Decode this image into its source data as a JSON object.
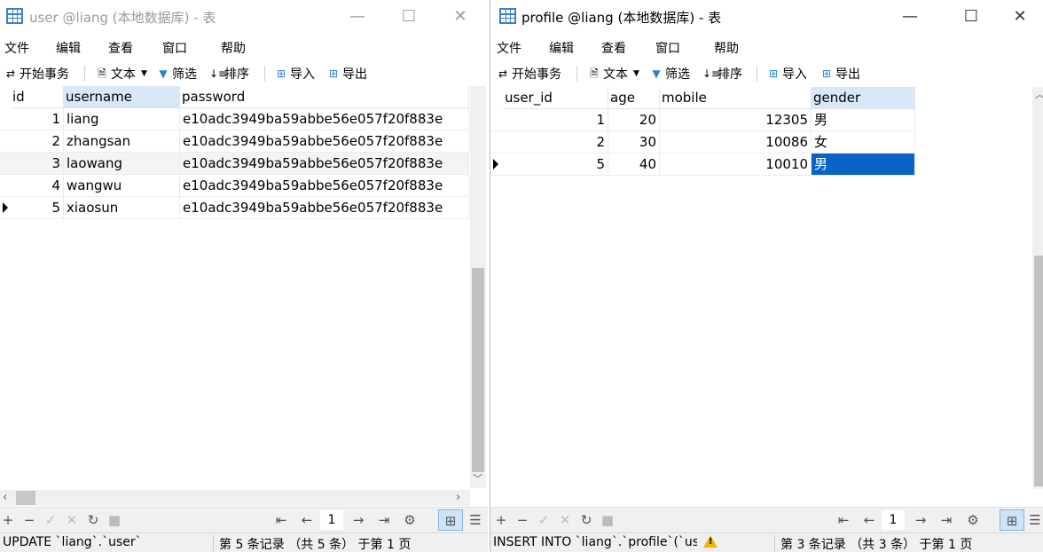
{
  "left": {
    "title": "user @liang (本地数据库) - 表",
    "menu": [
      "文件",
      "编辑",
      "查看",
      "窗口",
      "帮助"
    ],
    "toolbar": {
      "begin_tx": "开始事务",
      "text": "文本",
      "filter": "筛选",
      "sort": "排序",
      "import": "导入",
      "export": "导出"
    },
    "columns": [
      "id",
      "username",
      "password"
    ],
    "rows": [
      [
        "1",
        "liang",
        "e10adc3949ba59abbe56e057f20f883e"
      ],
      [
        "2",
        "zhangsan",
        "e10adc3949ba59abbe56e057f20f883e"
      ],
      [
        "3",
        "laowang",
        "e10adc3949ba59abbe56e057f20f883e"
      ],
      [
        "4",
        "wangwu",
        "e10adc3949ba59abbe56e057f20f883e"
      ],
      [
        "5",
        "xiaosun",
        "e10adc3949ba59abbe56e057f20f883e"
      ]
    ],
    "page": "1",
    "status_sql": "UPDATE `liang`.`user`",
    "status_records": "第 5 条记录 （共 5 条） 于第 1 页"
  },
  "right": {
    "title": "profile @liang (本地数据库) - 表",
    "menu": [
      "文件",
      "编辑",
      "查看",
      "窗口",
      "帮助"
    ],
    "toolbar": {
      "begin_tx": "开始事务",
      "text": "文本",
      "filter": "筛选",
      "sort": "排序",
      "import": "导入",
      "export": "导出"
    },
    "columns": [
      "user_id",
      "age",
      "mobile",
      "gender"
    ],
    "rows": [
      [
        "1",
        "20",
        "12305",
        "男"
      ],
      [
        "2",
        "30",
        "10086",
        "女"
      ],
      [
        "5",
        "40",
        "10010",
        "男"
      ]
    ],
    "page": "1",
    "status_sql": "INSERT INTO `liang`.`profile`(`use",
    "status_records": "第 3 条记录 （共 3 条） 于第 1 页"
  },
  "window_controls": {
    "minimize": "—",
    "maximize": "☐",
    "close": "✕"
  }
}
